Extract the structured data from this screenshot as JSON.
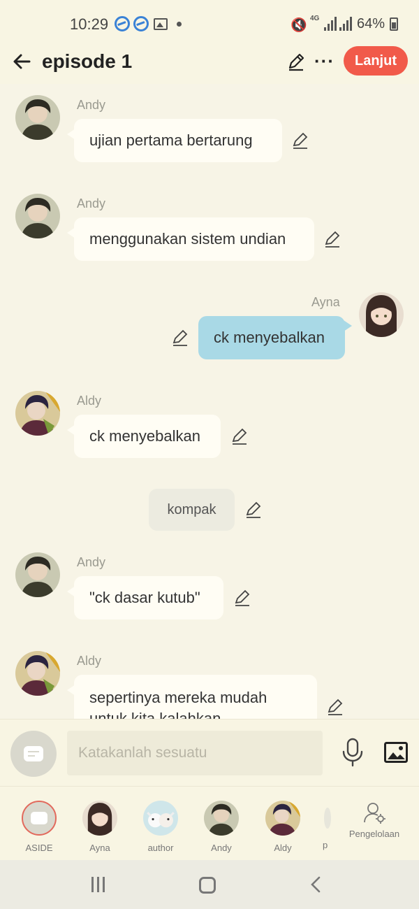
{
  "status_bar": {
    "time": "10:29",
    "network": "4G",
    "battery": "64%",
    "icons": [
      "s-app-icon",
      "s-app-icon",
      "image-icon",
      "dot-icon",
      "mute-icon",
      "signal-icon",
      "signal-icon",
      "battery-icon"
    ]
  },
  "header": {
    "title": "episode 1",
    "next_label": "Lanjut",
    "accent_color": "#f15a4a"
  },
  "messages": [
    {
      "sender": "Andy",
      "text": "ujian pertama bertarung",
      "side": "left",
      "avatar": "andy"
    },
    {
      "sender": "Andy",
      "text": "menggunakan sistem undian",
      "side": "left",
      "avatar": "andy"
    },
    {
      "sender": "Ayna",
      "text": "ck menyebalkan",
      "side": "right",
      "avatar": "ayna"
    },
    {
      "sender": "Aldy",
      "text": "ck menyebalkan",
      "side": "left",
      "avatar": "aldy"
    },
    {
      "sender": "",
      "text": "kompak",
      "side": "center",
      "avatar": ""
    },
    {
      "sender": "Andy",
      "text": "\"ck dasar kutub\"",
      "side": "left",
      "avatar": "andy"
    },
    {
      "sender": "Aldy",
      "text": "sepertinya mereka mudah untuk kita kalahkan",
      "side": "left",
      "avatar": "aldy"
    }
  ],
  "input": {
    "placeholder": "Katakanlah sesuatu"
  },
  "roles": [
    {
      "label": "ASIDE"
    },
    {
      "label": "Ayna"
    },
    {
      "label": "author"
    },
    {
      "label": "Andy"
    },
    {
      "label": "Aldy"
    },
    {
      "label": "p"
    }
  ],
  "manage_label": "Pengelolaan",
  "colors": {
    "background": "#f7f4e6",
    "bubble_left": "#fffdf4",
    "bubble_right": "#a9d9e6",
    "bubble_center": "#ecebe0"
  }
}
